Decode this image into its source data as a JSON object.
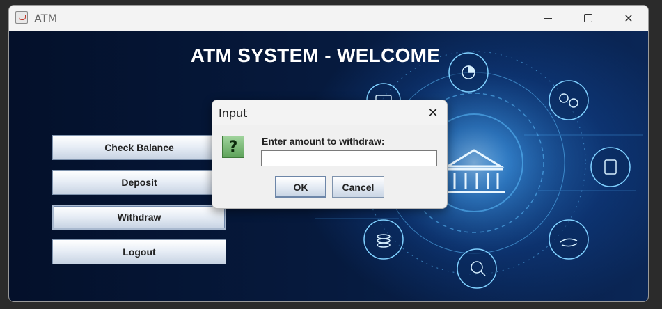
{
  "window": {
    "title": "ATM",
    "minimize_icon": "minimize-icon",
    "maximize_icon": "maximize-icon",
    "close_icon": "close-icon"
  },
  "main": {
    "heading": "ATM SYSTEM - WELCOME",
    "buttons": [
      {
        "label": "Check Balance"
      },
      {
        "label": "Deposit"
      },
      {
        "label": "Withdraw"
      },
      {
        "label": "Logout"
      }
    ],
    "background": "digital banking network illustration with bank building and finance icons"
  },
  "dialog": {
    "title": "Input",
    "icon": "question-icon",
    "prompt": "Enter amount to withdraw:",
    "input_value": "",
    "ok_label": "OK",
    "cancel_label": "Cancel"
  },
  "colors": {
    "background_dark": "#061a3e",
    "glow": "#3ca0ff",
    "button_border": "#7f93ad"
  }
}
